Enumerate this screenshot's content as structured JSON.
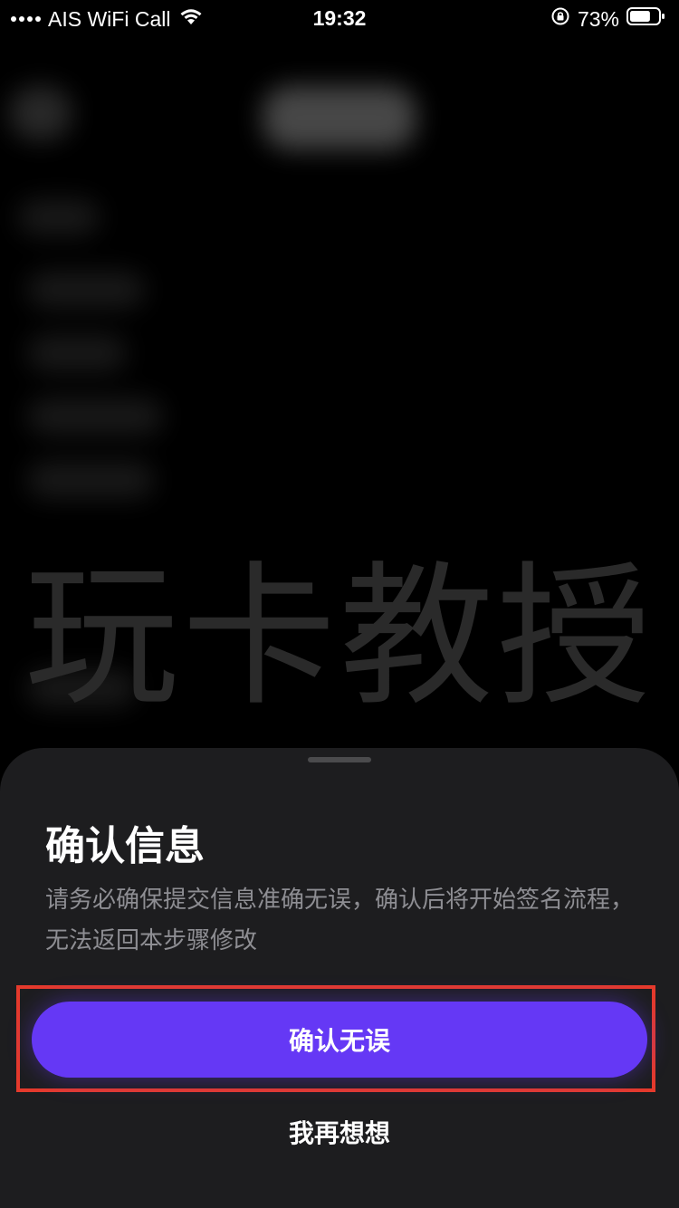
{
  "status_bar": {
    "carrier": "AIS WiFi Call",
    "time": "19:32",
    "battery_percent": "73%",
    "battery_level": 0.73,
    "wifi_icon": "wifi-icon",
    "lock_icon": "orientation-lock-icon",
    "battery_icon": "battery-icon"
  },
  "background": {
    "watermark_text": "玩卡教授"
  },
  "dialog": {
    "title": "确认信息",
    "description": "请务必确保提交信息准确无误，确认后将开始签名流程，无法返回本步骤修改",
    "confirm_label": "确认无误",
    "cancel_label": "我再想想"
  },
  "colors": {
    "accent": "#6538f5",
    "sheet_bg": "#1d1d1f",
    "highlight": "#e53a2c",
    "desc_text": "#8e8e93"
  }
}
